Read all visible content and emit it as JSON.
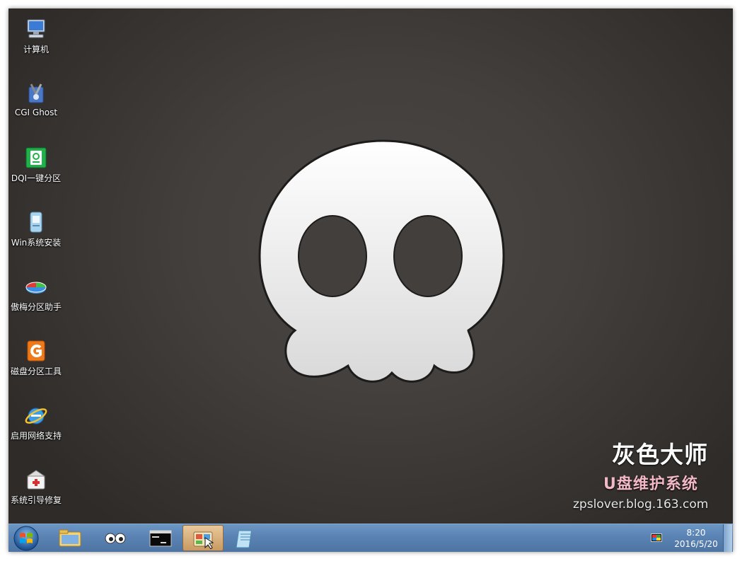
{
  "desktop": {
    "icons": [
      {
        "label": "计算机",
        "icon": "computer-icon"
      },
      {
        "label": "CGI Ghost",
        "icon": "cgi-ghost-icon"
      },
      {
        "label": "DQI一键分区",
        "icon": "disk-partition-icon"
      },
      {
        "label": "Win系统安装",
        "icon": "windows-install-icon"
      },
      {
        "label": "傲梅分区助手",
        "icon": "aomei-partition-icon"
      },
      {
        "label": "磁盘分区工具",
        "icon": "diskgenius-icon"
      },
      {
        "label": "启用网络支持",
        "icon": "internet-explorer-icon"
      },
      {
        "label": "系统引导修复",
        "icon": "boot-repair-icon"
      }
    ]
  },
  "branding": {
    "title": "灰色大师",
    "subtitle": "U盘维护系统",
    "url": "zpslover.blog.163.com"
  },
  "taskbar": {
    "start_icon": "windows-start-orb-icon",
    "buttons": [
      {
        "icon": "file-explorer-icon",
        "active": false
      },
      {
        "icon": "eyes-icon",
        "active": false
      },
      {
        "icon": "command-prompt-icon",
        "active": false
      },
      {
        "icon": "control-panel-icon",
        "active": true
      },
      {
        "icon": "notepad-icon",
        "active": false
      }
    ],
    "tray_icon": "display-icon",
    "clock": {
      "time": "8:20",
      "date": "2016/5/20"
    }
  },
  "colors": {
    "desktop_bg": "#433f3d",
    "taskbar": "#5a83b3",
    "subtitle": "#f3b8c8"
  }
}
